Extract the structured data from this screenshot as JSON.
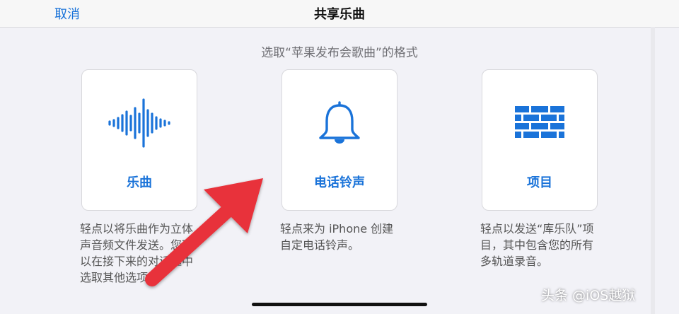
{
  "navbar": {
    "cancel_label": "取消",
    "title": "共享乐曲"
  },
  "subtitle": "选取“苹果发布会歌曲”的格式",
  "options": [
    {
      "label": "乐曲",
      "icon": "waveform-icon",
      "description": "轻点以将乐曲作为立体声音频文件发送。您可以在接下来的对话框中选取其他选项。"
    },
    {
      "label": "电话铃声",
      "icon": "bell-icon",
      "description": "轻点来为 iPhone 创建自定电话铃声。"
    },
    {
      "label": "项目",
      "icon": "bricks-icon",
      "description": "轻点以发送“库乐队”项目，其中包含您的所有多轨道录音。"
    }
  ],
  "watermark": "头条 @iOS越狱",
  "colors": {
    "accent": "#1a73d9",
    "arrow": "#e8303a",
    "background": "#f2f2f7"
  }
}
